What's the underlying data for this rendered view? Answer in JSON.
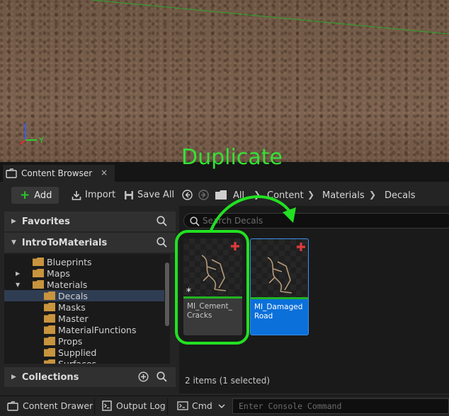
{
  "overlay": {
    "annotation_text": "Duplicate",
    "annotation_color": "#22e022"
  },
  "viewport": {
    "axis_y_label": "Y"
  },
  "tab": {
    "title": "Content Browser",
    "close_glyph": "×"
  },
  "toolbar": {
    "add_label": "Add",
    "import_label": "Import",
    "save_all_label": "Save All",
    "breadcrumbs": [
      "All",
      "Content",
      "Materials",
      "Decals"
    ]
  },
  "sidebar": {
    "favorites_label": "Favorites",
    "project_label": "IntroToMaterials",
    "collections_label": "Collections",
    "tree": [
      {
        "label": "Blueprints",
        "depth": 1,
        "expanded": false,
        "has_children": false
      },
      {
        "label": "Maps",
        "depth": 1,
        "expanded": false,
        "has_children": true
      },
      {
        "label": "Materials",
        "depth": 1,
        "expanded": true,
        "has_children": true
      },
      {
        "label": "Decals",
        "depth": 2,
        "expanded": false,
        "has_children": false,
        "selected": true
      },
      {
        "label": "Masks",
        "depth": 2,
        "expanded": false,
        "has_children": false
      },
      {
        "label": "Master",
        "depth": 2,
        "expanded": false,
        "has_children": false
      },
      {
        "label": "MaterialFunctions",
        "depth": 2,
        "expanded": false,
        "has_children": false
      },
      {
        "label": "Props",
        "depth": 2,
        "expanded": false,
        "has_children": false
      },
      {
        "label": "Supplied",
        "depth": 2,
        "expanded": false,
        "has_children": false
      },
      {
        "label": "Surfaces",
        "depth": 2,
        "expanded": false,
        "has_children": false
      }
    ]
  },
  "content": {
    "search_placeholder": "Search Decals",
    "assets": [
      {
        "name": "MI_Cement_ Cracks",
        "selected": false,
        "modified_marker": "*"
      },
      {
        "name": "MI_Damaged Road",
        "selected": true
      }
    ],
    "status": "2 items (1 selected)"
  },
  "bottom_bar": {
    "content_drawer_label": "Content Drawer",
    "output_log_label": "Output Log",
    "cmd_label": "Cmd",
    "console_placeholder": "Enter Console Command"
  },
  "colors": {
    "accent_blue": "#0b70da",
    "material_green": "#21b421",
    "add_green": "#29c829",
    "red_plus": "#e03a3a"
  }
}
